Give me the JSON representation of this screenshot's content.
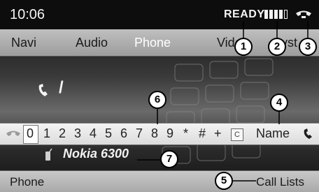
{
  "status": {
    "time": "10:06",
    "ready": "READY",
    "signal_level": 0.8
  },
  "menu": [
    "Navi",
    "Audio",
    "Phone",
    "Video",
    "Syst"
  ],
  "call": {
    "entry": "/"
  },
  "dialbar": {
    "chars": [
      "0",
      "1",
      "2",
      "3",
      "4",
      "5",
      "6",
      "7",
      "8",
      "9",
      "*",
      "#",
      "+"
    ],
    "clear": "C",
    "name": "Name"
  },
  "device": {
    "name": "Nokia 6300"
  },
  "bottom": {
    "left": "Phone",
    "right": "Call Lists"
  },
  "callouts": [
    "1",
    "2",
    "3",
    "4",
    "5",
    "6",
    "7"
  ],
  "colors": {
    "menu_active": "#ffffff",
    "bar_light": "#bfbfbf",
    "screen_dark": "#0d0d0d"
  }
}
